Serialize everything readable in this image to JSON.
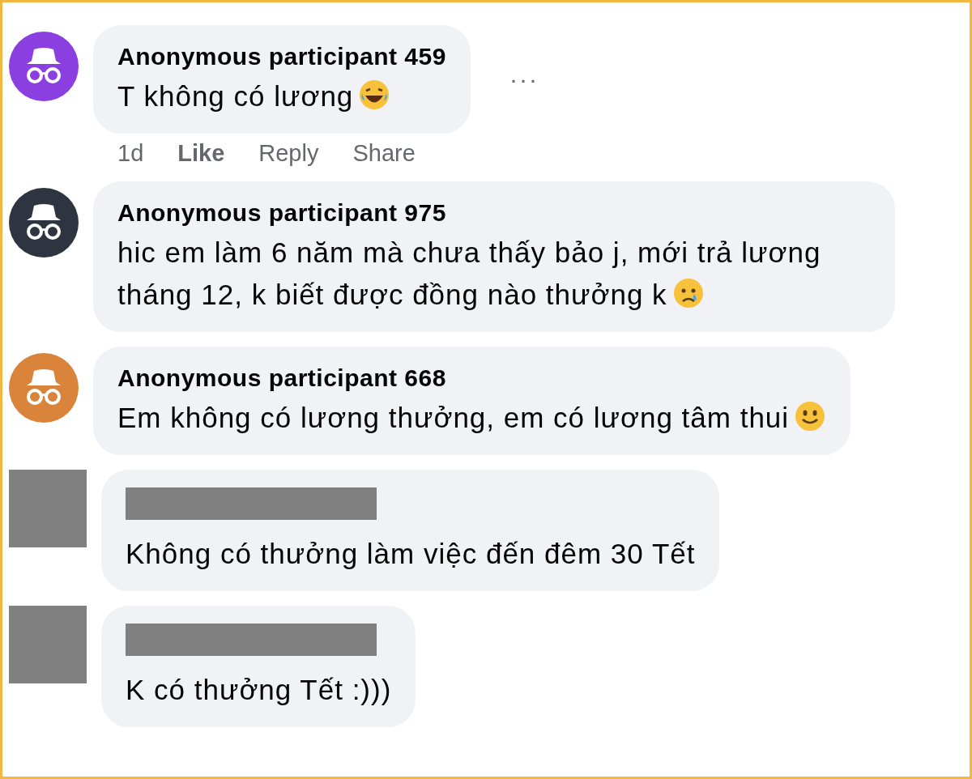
{
  "comments": [
    {
      "kind": "anonymous",
      "author": "Anonymous participant 459",
      "text": "T không có lương",
      "emoji": {
        "kind": "laugh"
      },
      "color": "#8b3fe0",
      "more": "···",
      "meta": {
        "time": "1d",
        "actions": [
          {
            "label": "Like",
            "bold": true
          },
          {
            "label": "Reply",
            "bold": false
          },
          {
            "label": "Share",
            "bold": false
          }
        ]
      }
    },
    {
      "kind": "anonymous",
      "author": "Anonymous participant 975",
      "text": "hic em làm 6 năm mà chưa thấy bảo j, mới trả lương tháng 12, k biết được đồng nào thưởng k",
      "emoji": {
        "kind": "cry"
      },
      "color": "#2f3540"
    },
    {
      "kind": "anonymous",
      "author": "Anonymous participant 668",
      "text": "Em không có lương thưởng, em có lương tâm thui",
      "emoji": {
        "kind": "smile"
      },
      "color": "#d9843a"
    },
    {
      "kind": "redacted",
      "text": "Không có thưởng làm việc đến đêm 30 Tết"
    },
    {
      "kind": "redacted",
      "text": "K có thưởng Tết :)))"
    }
  ]
}
